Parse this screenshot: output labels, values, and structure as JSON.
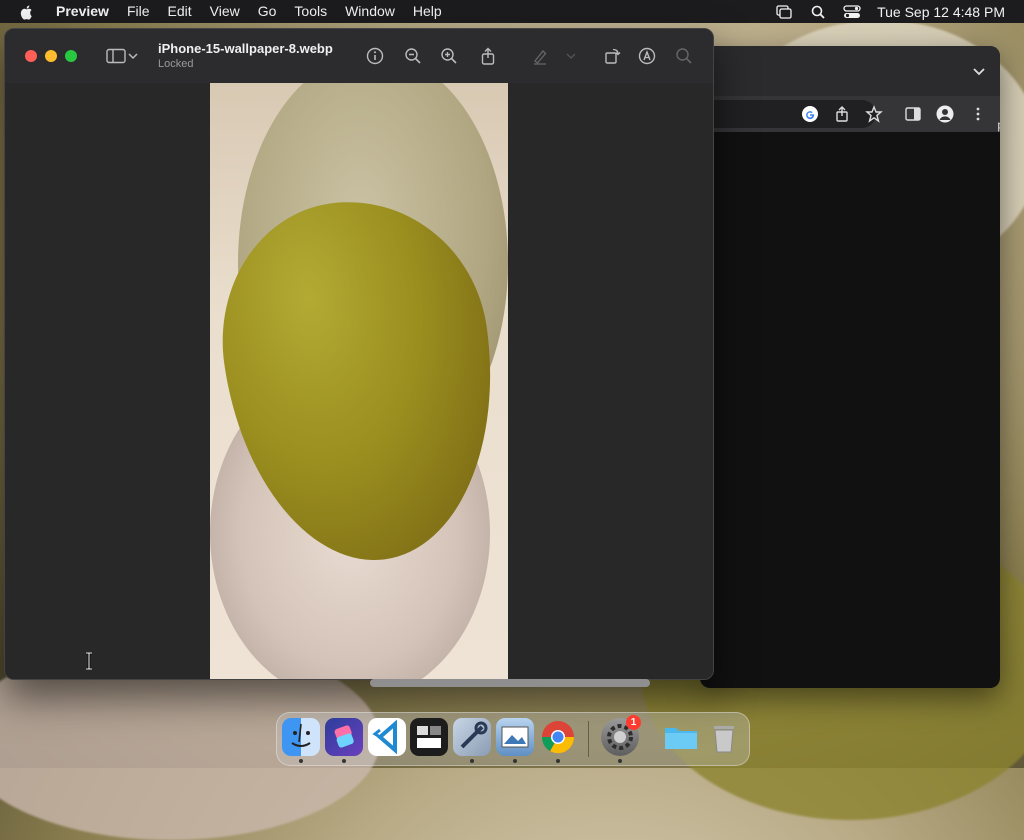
{
  "menubar": {
    "apple_icon": "apple-logo-icon",
    "app_name": "Preview",
    "items": [
      "File",
      "Edit",
      "View",
      "Go",
      "Tools",
      "Window",
      "Help"
    ],
    "status_icons": [
      "screen-mirroring-icon",
      "spotlight-search-icon",
      "control-center-icon"
    ],
    "clock": "Tue Sep 12  4:48 PM"
  },
  "preview": {
    "title": "iPhone-15-wallpaper-8.webp",
    "subtitle": "Locked",
    "toolbar_icons": [
      "sidebar-toggle-icon",
      "chevron-down-icon",
      "info-icon",
      "zoom-out-icon",
      "zoom-in-icon",
      "share-icon",
      "highlight-pen-icon",
      "rotate-icon",
      "markup-icon",
      "search-icon"
    ]
  },
  "chrome": {
    "icons": [
      "google-icon",
      "share-icon",
      "bookmark-star-icon",
      "side-panel-icon",
      "profile-icon",
      "more-menu-icon",
      "tab-list-chevron-icon"
    ],
    "peek_text": "p"
  },
  "dock": {
    "apps": [
      "Finder",
      "Shortcuts",
      "Visual Studio Code",
      "Image Capture",
      "Xcode Instruments",
      "Preview",
      "Google Chrome",
      "System Settings",
      "Downloads",
      "Trash"
    ],
    "system_settings_badge": "1"
  },
  "colors": {
    "menubar_bg": "#1c1c1e",
    "window_bg": "#282828",
    "close": "#ff5f57",
    "minimize": "#febc2e",
    "maximize": "#28c840",
    "badge": "#ff3b30"
  }
}
